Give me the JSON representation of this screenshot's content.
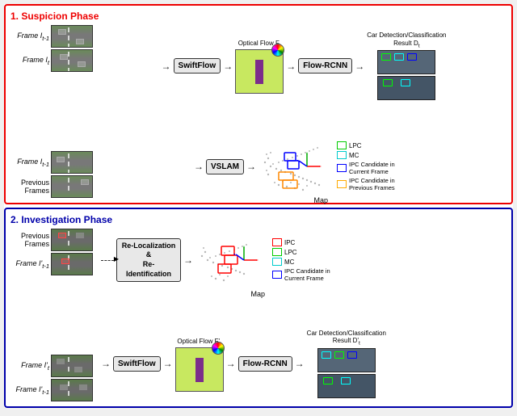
{
  "phase1": {
    "title": "1. Suspicion Phase",
    "frames": {
      "f_t_minus_1": "Frame I",
      "f_t_minus_1_sub": "t-1",
      "f_t": "Frame I",
      "f_t_sub": "t",
      "f_t_minus_2": "Frame I",
      "f_t_minus_2_sub": "t-1",
      "previous": "Previous",
      "frames": "Frames"
    },
    "swiftflow": "SwiftFlow",
    "vslam": "VSLAM",
    "flow_rcnn": "Flow-RCNN",
    "optical_flow_label": "Optical Flow F",
    "optical_flow_sub": "t",
    "map_label": "Map",
    "result_label": "Car Detection/Classification",
    "result_sub": "Result D",
    "result_sub2": "t",
    "legend": {
      "lpc": "LPC",
      "mc": "MC",
      "ipc_current": "IPC Candidate in Current Frame",
      "ipc_previous": "IPC Candidate in Previous Frames"
    },
    "legend_colors": {
      "lpc": "#00cc00",
      "mc": "#00cccc",
      "ipc_current": "#0000ff",
      "ipc_previous": "#ffaa00"
    }
  },
  "phase2": {
    "title": "2. Investigation Phase",
    "previous_frames": "Previous Frames",
    "frame_t_minus_1_prime": "Frame I'",
    "frame_t_minus_1_prime_sub": "t-1",
    "frame_t_prime": "Frame I'",
    "frame_t_prime_sub": "t",
    "frame_t_minus_1_prime2": "Frame I'",
    "frame_t_minus_1_prime2_sub": "t-1",
    "reloc_label1": "Re-Localization &",
    "reloc_label2": "Re-Identification",
    "swiftflow": "SwiftFlow",
    "flow_rcnn": "Flow-RCNN",
    "optical_flow_label": "Optical Flow F'",
    "optical_flow_sub": "t",
    "map_label": "Map",
    "result_label": "Car Detection/Classification",
    "result_sub": "Result D'",
    "result_sub2": "t",
    "legend": {
      "ipc": "IPC",
      "lpc": "LPC",
      "mc": "MC",
      "ipc_current": "IPC Candidate in Current Frame"
    },
    "legend_colors": {
      "ipc": "#ff0000",
      "lpc": "#00cc00",
      "mc": "#00cccc",
      "ipc_current": "#0000ff"
    }
  }
}
